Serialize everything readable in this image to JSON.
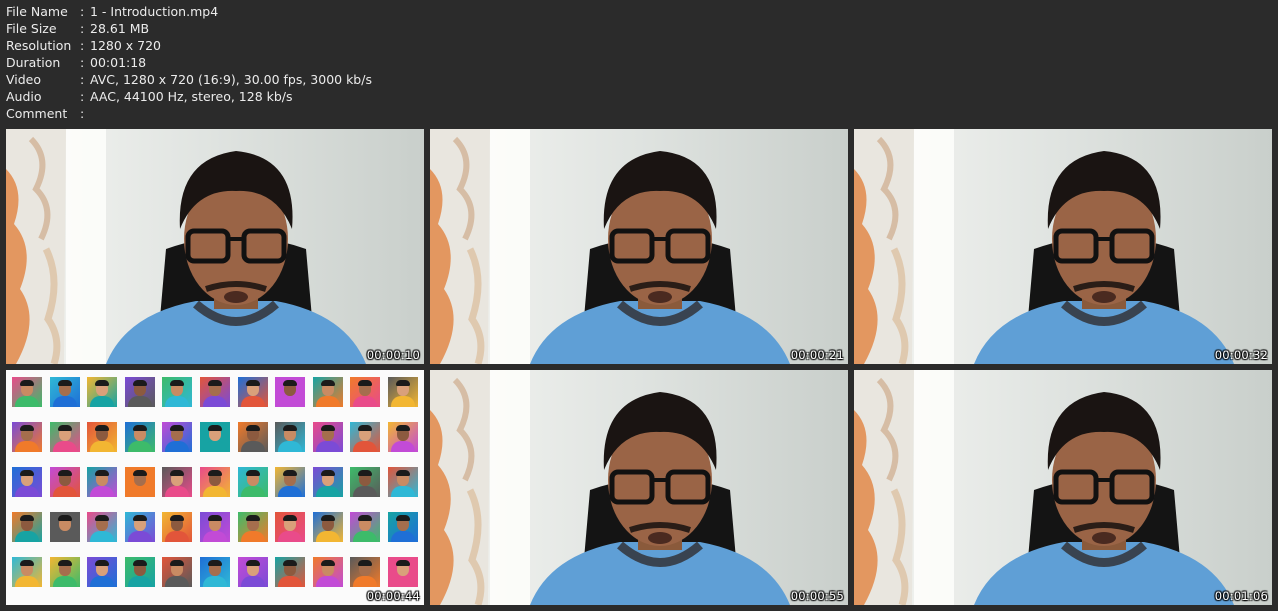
{
  "metadata": {
    "rows": [
      {
        "key": "File Name",
        "sep": ":",
        "value": "1 - Introduction.mp4"
      },
      {
        "key": "File Size",
        "sep": ":",
        "value": "28.61 MB"
      },
      {
        "key": "Resolution",
        "sep": ":",
        "value": "1280 x 720"
      },
      {
        "key": "Duration",
        "sep": ":",
        "value": "00:01:18"
      },
      {
        "key": "Video",
        "sep": ":",
        "value": "AVC, 1280 x 720 (16:9), 30.00 fps, 3000 kb/s"
      },
      {
        "key": "Audio",
        "sep": ":",
        "value": "AAC, 44100 Hz, stereo, 128 kb/s"
      },
      {
        "key": "Comment",
        "sep": ":",
        "value": ""
      }
    ]
  },
  "thumbnails": [
    {
      "timestamp": "00:00:10",
      "scene": "person"
    },
    {
      "timestamp": "00:00:21",
      "scene": "person"
    },
    {
      "timestamp": "00:00:32",
      "scene": "person"
    },
    {
      "timestamp": "00:00:44",
      "scene": "collage"
    },
    {
      "timestamp": "00:00:55",
      "scene": "person"
    },
    {
      "timestamp": "00:01:06",
      "scene": "person"
    }
  ],
  "colors": {
    "background": "#2b2b2b",
    "text": "#ececec",
    "shirt": "#5f9fd6",
    "wall": "#dfe3e0",
    "curtain": "#e2884a"
  }
}
